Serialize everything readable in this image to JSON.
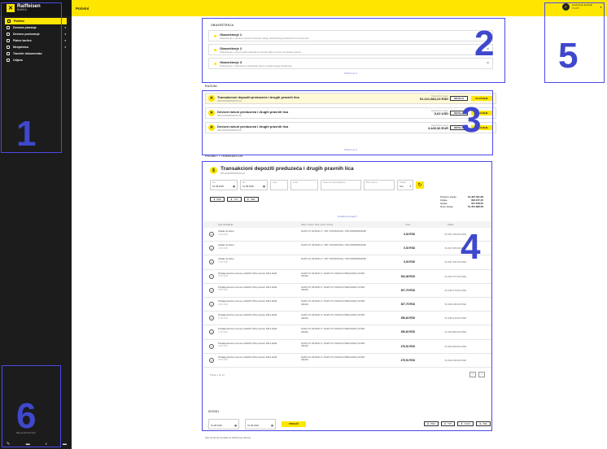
{
  "sidebar": {
    "logo_name": "Raiffeisen",
    "logo_sub": "BANKA",
    "items": [
      {
        "label": "Početni",
        "icon": "home-icon",
        "active": true,
        "chevron": false
      },
      {
        "label": "Domaća plaćanja",
        "icon": "transfer-icon",
        "active": false,
        "chevron": true
      },
      {
        "label": "Devizno poslovanje",
        "icon": "exchange-icon",
        "active": false,
        "chevron": true
      },
      {
        "label": "Platne kartice",
        "icon": "card-icon",
        "active": false,
        "chevron": true
      },
      {
        "label": "Menjačnica",
        "icon": "currency-icon",
        "active": false,
        "chevron": true
      },
      {
        "label": "Transfer dokumenata",
        "icon": "document-icon",
        "active": false,
        "chevron": false
      },
      {
        "label": "Odjava",
        "icon": "logout-icon",
        "active": false,
        "chevron": false
      }
    ],
    "footer_text": "Moj servis    Pomoć",
    "footer_icons": [
      "settings-icon",
      "messages-icon",
      "facebook-icon",
      "menu-icon"
    ]
  },
  "header": {
    "title": "Početni",
    "user_initial": "P",
    "user_name": "preduzeće korisnik",
    "user_sub": "PL005"
  },
  "labels": {
    "n1": "1",
    "n2": "2",
    "n3": "3",
    "n4": "4",
    "n5": "5",
    "n6": "6"
  },
  "notifications": {
    "title": "OBAVEŠTENJA",
    "items": [
      {
        "title": "Obaveštenje 1",
        "text": "Obaveštenje o promeni uslova korišćenja usluge elektronskog bankarstva za pravna lica"
      },
      {
        "title": "Obaveštenje 2",
        "text": "Obaveštenje o izmeni tarife naknada za domaći platni promet od naredne godine"
      },
      {
        "title": "Obaveštenje 3",
        "text": "Obaveštenje o planiranom održavanju sistema elektronskog bankarstva"
      }
    ],
    "more": "Prikaži sve"
  },
  "accounts": {
    "title": "RAČUNI",
    "items": [
      {
        "name": "Transakcioni depoziti preduzeća i drugih pravnih lica",
        "number": "265-0000000000000-00",
        "balance_label": "Raspoloživo stanje",
        "balance": "51.221.884,23 RSD",
        "selected": true
      },
      {
        "name": "Devizni računi preduzeća i drugih pravnih lica",
        "number": "265-0000000000000-00",
        "balance_label": "Raspoloživo stanje",
        "balance": "9,62 USD",
        "selected": false
      },
      {
        "name": "Devizni računi preduzeća i drugih pravnih lica",
        "number": "265-0000000000000-00",
        "balance_label": "Raspoloživo stanje",
        "balance": "3.445,36 EUR",
        "selected": false
      }
    ],
    "btn_details": "DETALJI",
    "btn_pay": "PLAĆANJE",
    "more": "Prikaži sve"
  },
  "transactions": {
    "section_title": "PROMET I TRANSAKCIJE",
    "account_title": "Transakcioni depoziti preduzeća i drugih pravnih lica",
    "account_number": "265-0000000000000-00",
    "filters": [
      {
        "label": "Od",
        "value": "01.08.2020"
      },
      {
        "label": "Do",
        "value": "31.08.2020"
      },
      {
        "label": "Opis",
        "value": ""
      },
      {
        "label": "Iznos",
        "value": ""
      },
      {
        "label": "Naziv primaoca/platioca",
        "value": ""
      },
      {
        "label": "Broj računa",
        "value": ""
      },
      {
        "label": "Prikaži",
        "value": "Sve"
      }
    ],
    "chips": [
      "PDF",
      "TXT",
      "XML"
    ],
    "summary": [
      {
        "label": "Početno stanje",
        "value": "51.497.461,68"
      },
      {
        "label": "Uplate",
        "value": "303.157,45"
      },
      {
        "label": "Isplate",
        "value": "347.618,55"
      },
      {
        "label": "Novo stanje",
        "value": "51.451.998,58"
      }
    ],
    "more_filters": "Detaljna pretraga",
    "columns": [
      "Opis transakcije",
      "Naziv / račun / šifra / poziv na broj",
      "Iznos",
      "Stanje"
    ],
    "rows": [
      {
        "desc": "Uplata na račun",
        "date": "31.08.2020",
        "name": "NAZIV PL 0016/20 Z / VRT VODORAVNA / 265-0000000000000",
        "amount": "5,30 RSD",
        "balance": "51.497.456,00 RSD"
      },
      {
        "desc": "Uplata na račun",
        "date": "31.08.2020",
        "name": "NAZIV PL 0016/20 Z / VRT VODORAVNA / 265-0000000000000",
        "amount": "5,30 RSD",
        "balance": "51.497.456,00 RSD"
      },
      {
        "desc": "Uplata na račun",
        "date": "31.08.2020",
        "name": "NAZIV PL 0016/20 Z / VRT VODORAVNA / 265-0000000000000",
        "amount": "5,30 RSD",
        "balance": "51.497.451,50 RSD"
      },
      {
        "desc": "Prodaja deviza u iznosu od EUR 3,00 po kursu 118,1 EUR",
        "date": "28.08.2020",
        "name": "NAZIV PL 0016/20 Z / NAZIV PL 0016/20 Z BEOGRAD (STARI GRAD)",
        "amount": "394,38 RSD",
        "balance": "51.497.077,00 RSD"
      },
      {
        "desc": "Prodaja deviza u iznosu od EUR 3,00 po kursu 118,1 EUR",
        "date": "28.08.2020",
        "name": "NAZIV PL 0016/20 Z / NAZIV PL 0016/20 Z BEOGRAD (STARI GRAD)",
        "amount": "307,75 RSD",
        "balance": "51.496.475,00 RSD"
      },
      {
        "desc": "Prodaja deviza u iznosu od EUR 3,00 po kursu 118,1 EUR",
        "date": "28.08.2020",
        "name": "NAZIV PL 0016/20 Z / NAZIV PL 0016/20 Z BEOGRAD (STARI GRAD)",
        "amount": "307,75 RSD",
        "balance": "51.496.166,00 RSD"
      },
      {
        "desc": "Prodaja deviza u iznosu od EUR 3,00 po kursu 118,1 EUR",
        "date": "27.08.2020",
        "name": "NAZIV PL 0016/20 Z / NAZIV PL 0016/20 Z BEOGRAD (STARI GRAD)",
        "amount": "356,62 RSD",
        "balance": "51.495.219,00 RSD"
      },
      {
        "desc": "Prodaja deviza u iznosu od EUR 3,00 po kursu 118,1 EUR",
        "date": "27.08.2020",
        "name": "NAZIV PL 0016/20 Z / NAZIV PL 0016/20 Z BEOGRAD (STARI GRAD)",
        "amount": "356,62 RSD",
        "balance": "51.494.862,00 RSD"
      },
      {
        "desc": "Prodaja deviza u iznosu od EUR 3,00 po kursu 118,1 EUR",
        "date": "26.08.2020",
        "name": "NAZIV PL 0016/20 Z / NAZIV PL 0016/20 Z BEOGRAD (STARI GRAD)",
        "amount": "475,51 RSD",
        "balance": "51.494.505,00 RSD"
      },
      {
        "desc": "Prodaja deviza u iznosu od EUR 3,00 po kursu 118,1 EUR",
        "date": "26.08.2020",
        "name": "NAZIV PL 0016/20 Z / NAZIV PL 0016/20 Z BEOGRAD (STARI GRAD)",
        "amount": "475,51 RSD",
        "balance": "51.494.030,00 RSD"
      }
    ],
    "pagination_info": "Prikaz 1 do 10",
    "pager_prev": "‹",
    "pager_next": "›"
  },
  "statements": {
    "title": "IZVODI",
    "from": "01.08.2020",
    "to": "31.08.2020",
    "btn": "PRIKAŽI",
    "chips": [
      "PDF",
      "TXT",
      "XLSX",
      "XML"
    ]
  },
  "footnote": "Nije izvršena prodaja sa izabranog računa"
}
